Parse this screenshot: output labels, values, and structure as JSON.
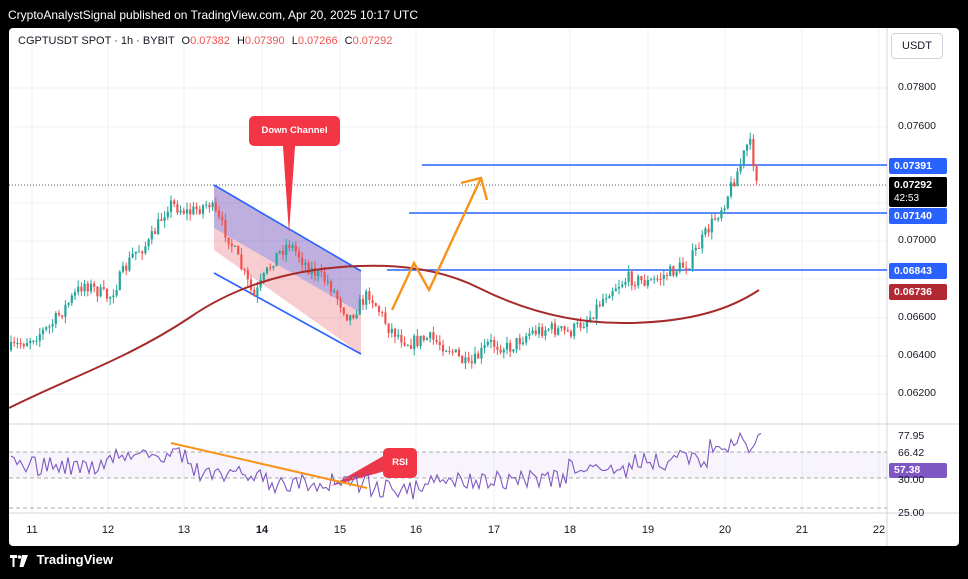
{
  "header": {
    "publish_text": "CryptoAnalystSignal published on TradingView.com, Apr 20, 2025 10:17 UTC"
  },
  "legend": {
    "symbol": "CGPTUSDT SPOT · 1h · BYBIT",
    "open_key": "O",
    "open": "0.07382",
    "high_key": "H",
    "high": "0.07390",
    "low_key": "L",
    "low": "0.07266",
    "close_key": "C",
    "close": "0.07292"
  },
  "currency": "USDT",
  "y_axis_ticks": [
    "0.07800",
    "0.07600",
    "0.07000",
    "0.06600",
    "0.06400",
    "0.06200"
  ],
  "price_labels": {
    "level_high": {
      "value": "0.07391",
      "color": "#2962ff"
    },
    "last_price": {
      "value": "0.07292",
      "countdown": "42:53",
      "color": "#000000"
    },
    "level_mid": {
      "value": "0.07140",
      "color": "#2962ff"
    },
    "level_low": {
      "value": "0.06843",
      "color": "#2962ff"
    },
    "ma_value": {
      "value": "0.06736",
      "color": "#b22833"
    }
  },
  "rsi_axis": {
    "ticks": [
      "77.95",
      "66.42",
      "30.00",
      "25.00"
    ],
    "current": {
      "value": "57.38",
      "color": "#7e57c2"
    }
  },
  "x_axis_labels": [
    "11",
    "12",
    "13",
    "14",
    "15",
    "16",
    "17",
    "18",
    "19",
    "20",
    "21",
    "22"
  ],
  "annotations": {
    "channel_label": "Down Channel",
    "rsi_label": "RSI"
  },
  "colors": {
    "up": "#26a69a",
    "down": "#ef5350",
    "level": "#2962ff",
    "ma": "#a52a2a",
    "arrow": "#f7931a",
    "rsi": "#7e57c2"
  },
  "footer": {
    "brand": "TradingView"
  }
}
